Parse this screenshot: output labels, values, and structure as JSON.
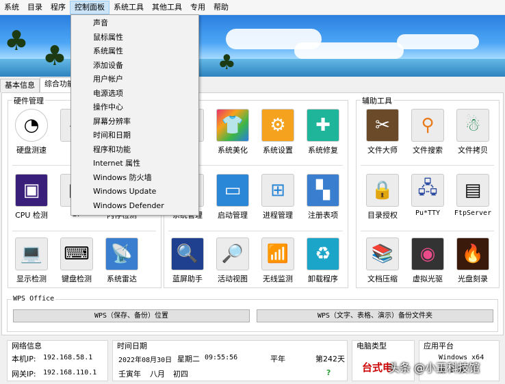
{
  "menu": [
    "系统",
    "目录",
    "程序",
    "控制面板",
    "系统工具",
    "其他工具",
    "专用",
    "帮助"
  ],
  "dropdown": [
    "声音",
    "鼠标属性",
    "系统属性",
    "添加设备",
    "用户帐户",
    "电源选项",
    "操作中心",
    "屏幕分辨率",
    "时间和日期",
    "程序和功能",
    "Internet 属性",
    "Windows 防火墙",
    "Windows Update",
    "Windows Defender"
  ],
  "tabs": [
    "基本信息",
    "综合功能"
  ],
  "hardware": {
    "title": "硬件管理",
    "row1": [
      "硬盘测速",
      "硬"
    ],
    "row2": [
      "CPU 检测",
      "GP",
      "内存检测"
    ],
    "row3": [
      "显示检测",
      "键盘检测",
      "系统雷达"
    ]
  },
  "middle": {
    "row1": [
      "化",
      "系统美化",
      "系统设置",
      "系统修复"
    ],
    "row2": [
      "系统管理",
      "启动管理",
      "进程管理",
      "注册表项"
    ],
    "row3": [
      "蓝屏助手",
      "活动视图",
      "无线监测",
      "卸载程序"
    ]
  },
  "aux": {
    "title": "辅助工具",
    "row1": [
      "文件大师",
      "文件搜索",
      "文件拷贝"
    ],
    "row2": [
      "目录授权",
      "Pu*TTY",
      "FtpServer"
    ],
    "row3": [
      "文档压缩",
      "虚拟光驱",
      "光盘刻录"
    ]
  },
  "wps": {
    "title": "WPS Office",
    "btn1": "WPS（保存、备份）位置",
    "btn2": "WPS（文字、表格、演示）备份文件夹"
  },
  "network": {
    "title": "网络信息",
    "ip_label": "本机IP:",
    "ip": "192.168.58.1",
    "gw_label": "网关IP:",
    "gw": "192.168.110.1"
  },
  "datetime": {
    "title": "时间日期",
    "date": "2022年08月30日",
    "weekday": "星期二",
    "time": "09:55:56",
    "year_type": "平年",
    "day_of_year": "第242天",
    "ganzhi": "壬寅年",
    "month": "八月",
    "day": "初四",
    "question": "?"
  },
  "pc": {
    "title": "电脑类型",
    "value": "台式电"
  },
  "platform": {
    "title": "应用平台",
    "line1": "Windows x64",
    "line2": "版 1 次"
  },
  "watermark": "头条 @小王科技馆",
  "colors": {
    "accent": "#cc0000",
    "menu_highlight": "#cce4f7"
  }
}
